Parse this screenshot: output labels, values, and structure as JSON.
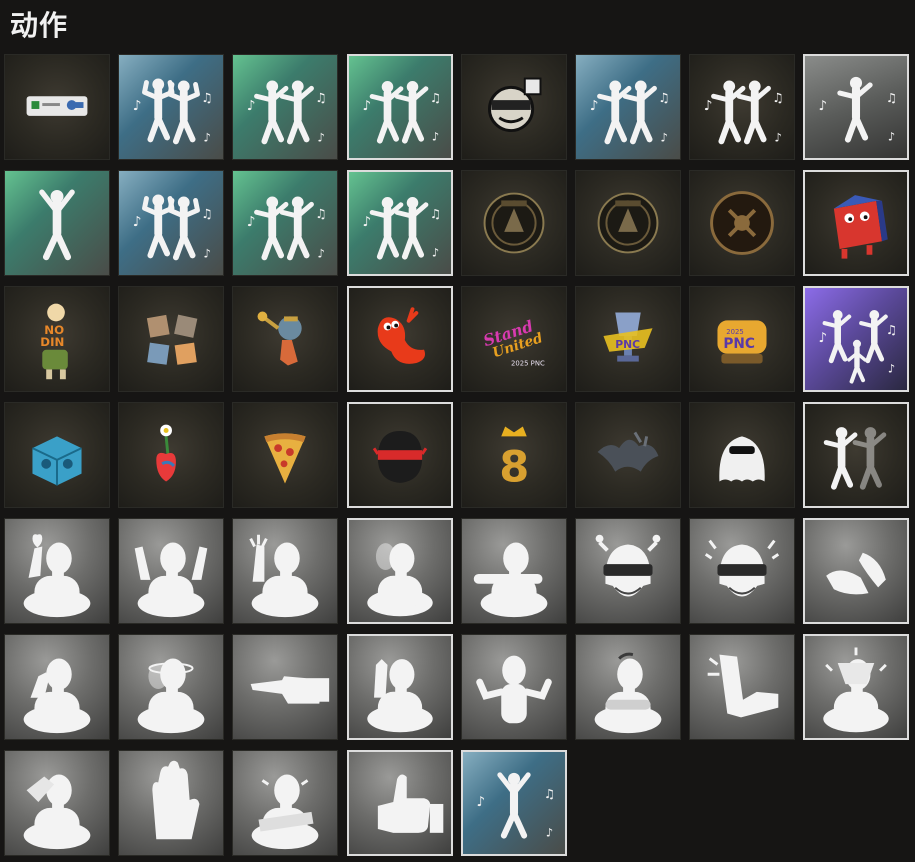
{
  "page": {
    "title": "动作"
  },
  "tiles": [
    {
      "icon": "sticker-chat-icon",
      "bg": "dark",
      "selected": false
    },
    {
      "icon": "duo-flex-dance-icon",
      "bg": "blue",
      "selected": false
    },
    {
      "icon": "duo-dance-icon",
      "bg": "green",
      "selected": false
    },
    {
      "icon": "duo-dance-icon",
      "bg": "green",
      "selected": true
    },
    {
      "icon": "helmet-sticker-icon",
      "bg": "dark",
      "selected": false
    },
    {
      "icon": "duo-dance-icon",
      "bg": "blue",
      "selected": false
    },
    {
      "icon": "duo-dance-icon",
      "bg": "dark",
      "selected": false
    },
    {
      "icon": "solo-dance-icon",
      "bg": "steel",
      "selected": true
    },
    {
      "icon": "star-jump-icon",
      "bg": "green",
      "selected": false
    },
    {
      "icon": "duo-flex-dance-icon",
      "bg": "blue",
      "selected": false
    },
    {
      "icon": "duo-dance-icon",
      "bg": "green",
      "selected": false
    },
    {
      "icon": "duo-dance-icon",
      "bg": "green",
      "selected": true
    },
    {
      "icon": "pcs-badge-icon",
      "bg": "dark",
      "selected": false
    },
    {
      "icon": "pcs-badge-icon",
      "bg": "dark",
      "selected": false
    },
    {
      "icon": "glory-badge-icon",
      "bg": "dark",
      "selected": false
    },
    {
      "icon": "crate-mascot-icon",
      "bg": "dark",
      "selected": true
    },
    {
      "icon": "no-dinner-icon",
      "bg": "dark",
      "selected": false
    },
    {
      "icon": "cat-grid-icon",
      "bg": "dark",
      "selected": false
    },
    {
      "icon": "running-character-icon",
      "bg": "dark",
      "selected": false
    },
    {
      "icon": "chili-mascot-icon",
      "bg": "dark",
      "selected": true
    },
    {
      "icon": "stand-united-icon",
      "bg": "dark",
      "selected": false
    },
    {
      "icon": "pnc-trophy-icon",
      "bg": "dark",
      "selected": false
    },
    {
      "icon": "pnc-badge-icon",
      "bg": "dark",
      "selected": false
    },
    {
      "icon": "group-dance-icon",
      "bg": "purple",
      "selected": true
    },
    {
      "icon": "cube-icon",
      "bg": "dark",
      "selected": false
    },
    {
      "icon": "flower-heart-icon",
      "bg": "dark",
      "selected": false
    },
    {
      "icon": "pizza-icon",
      "bg": "dark",
      "selected": false
    },
    {
      "icon": "masked-helmet-icon",
      "bg": "dark",
      "selected": true
    },
    {
      "icon": "crown-eight-icon",
      "bg": "dark",
      "selected": false
    },
    {
      "icon": "splash-icon",
      "bg": "dark",
      "selected": false
    },
    {
      "icon": "ghost-icon",
      "bg": "dark",
      "selected": false
    },
    {
      "icon": "shadow-boxing-icon",
      "bg": "dark",
      "selected": true
    },
    {
      "icon": "heart-hand-icon",
      "bg": "gray",
      "selected": false
    },
    {
      "icon": "hands-up-icon",
      "bg": "gray",
      "selected": false
    },
    {
      "icon": "wave-icon",
      "bg": "gray",
      "selected": false
    },
    {
      "icon": "look-back-icon",
      "bg": "gray",
      "selected": true
    },
    {
      "icon": "lean-arm-icon",
      "bg": "gray",
      "selected": false
    },
    {
      "icon": "helmet-dizzy-icon",
      "bg": "gray",
      "selected": false
    },
    {
      "icon": "helmet-laugh-icon",
      "bg": "gray",
      "selected": false
    },
    {
      "icon": "clap-hands-icon",
      "bg": "gray",
      "selected": true
    },
    {
      "icon": "think-icon",
      "bg": "gray",
      "selected": false
    },
    {
      "icon": "dizzy-icon",
      "bg": "gray",
      "selected": false
    },
    {
      "icon": "point-icon",
      "bg": "gray",
      "selected": false
    },
    {
      "icon": "salute-icon",
      "bg": "gray",
      "selected": true
    },
    {
      "icon": "shrug-icon",
      "bg": "gray",
      "selected": false
    },
    {
      "icon": "arms-crossed-icon",
      "bg": "gray",
      "selected": false
    },
    {
      "icon": "kick-icon",
      "bg": "gray",
      "selected": false
    },
    {
      "icon": "facepalm-icon",
      "bg": "gray",
      "selected": true
    },
    {
      "icon": "cover-face-icon",
      "bg": "gray",
      "selected": false
    },
    {
      "icon": "stop-hand-icon",
      "bg": "gray",
      "selected": false
    },
    {
      "icon": "cross-arms-icon",
      "bg": "gray",
      "selected": false
    },
    {
      "icon": "thumbs-up-icon",
      "bg": "gray",
      "selected": true
    },
    {
      "icon": "victory-dance-icon",
      "bg": "blue",
      "selected": true
    }
  ]
}
